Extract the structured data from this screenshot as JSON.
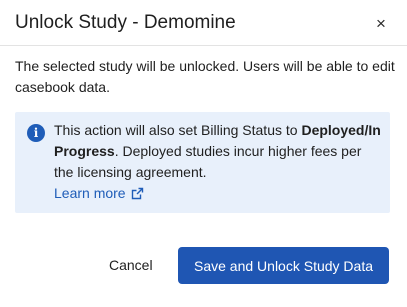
{
  "dialog": {
    "title": "Unlock Study - Demomine",
    "close_glyph": "×",
    "description": "The selected study will be unlocked. Users will be able to edit casebook data.",
    "info": {
      "icon": "info-icon",
      "icon_glyph": "i",
      "text_before": "This action will also set Billing Status to",
      "text_bold": "Deployed/In Progress",
      "text_after": ". Deployed studies incur higher fees per the licensing agreement.",
      "link_label": "Learn more",
      "link_icon": "external-link-icon"
    },
    "cancel_label": "Cancel",
    "primary_label": "Save and Unlock Study Data"
  },
  "colors": {
    "primary": "#1f56b3",
    "info_background": "#e8f0fb",
    "link": "#1f5db8"
  }
}
